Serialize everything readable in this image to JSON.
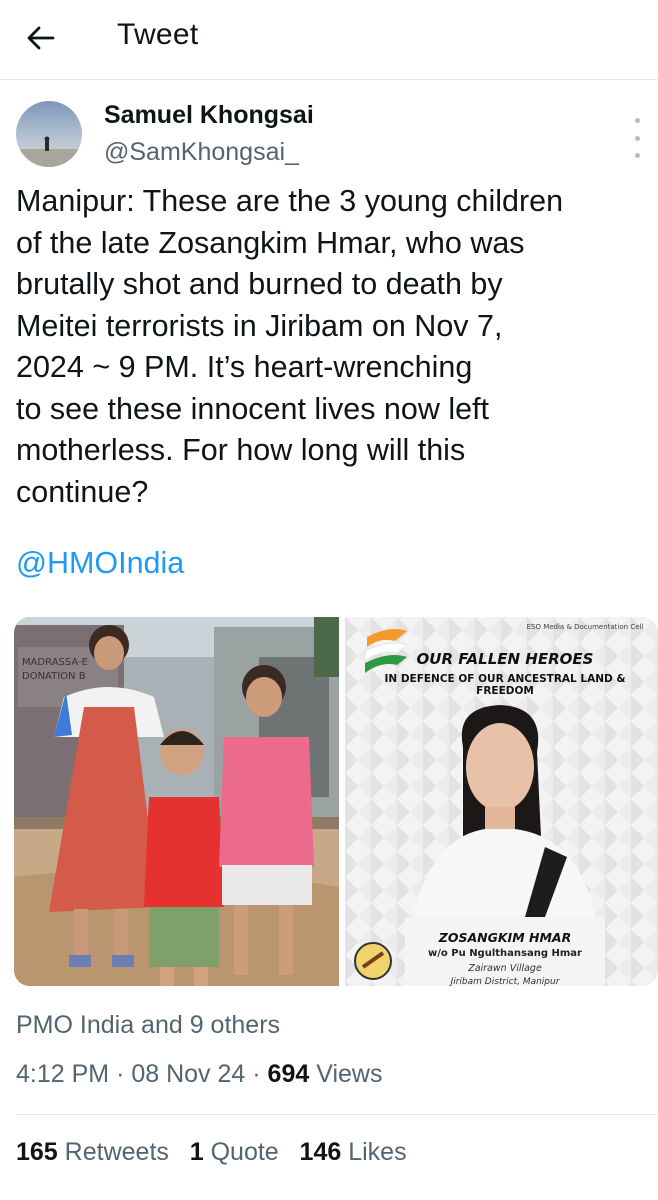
{
  "header": {
    "title": "Tweet",
    "back_icon": "arrow-left-icon"
  },
  "author": {
    "name": "Samuel Khongsai",
    "handle": "@SamKhongsai_"
  },
  "tweet": {
    "text": "Manipur: These are the 3 young children\nof the late Zosangkim Hmar, who was\nbrutally shot and burned to death by\nMeitei terrorists in Jiribam on Nov 7,\n2024 ~ 9 PM. It’s heart-wrenching\nto see these innocent lives now left\nmotherless. For how long will this\ncontinue?",
    "mention": "@HMOIndia"
  },
  "poster": {
    "org": "ESO Media & Documentation Cell",
    "title": "OUR FALLEN HEROES",
    "subtitle": "IN DEFENCE OF OUR ANCESTRAL LAND & FREEDOM",
    "name": "ZOSANGKIM HMAR",
    "wife_of": "w/o Pu Ngulthansang Hmar",
    "village": "Zairawn Village",
    "district": "Jiribam District, Manipur"
  },
  "photo_sign": {
    "line1": "MADRASSA-E",
    "line2": "DONATION B"
  },
  "liked_by": "PMO India and 9 others",
  "meta": {
    "time": "4:12 PM",
    "date": "08 Nov 24",
    "views_count": "694",
    "views_label": "Views",
    "sep": "·"
  },
  "stats": {
    "retweets_count": "165",
    "retweets_label": "Retweets",
    "quotes_count": "1",
    "quotes_label": "Quote",
    "likes_count": "146",
    "likes_label": "Likes"
  },
  "colors": {
    "link": "#1d9bf0",
    "secondary_text": "#536471",
    "primary_text": "#0f1419",
    "divider": "#e6e9eb"
  }
}
